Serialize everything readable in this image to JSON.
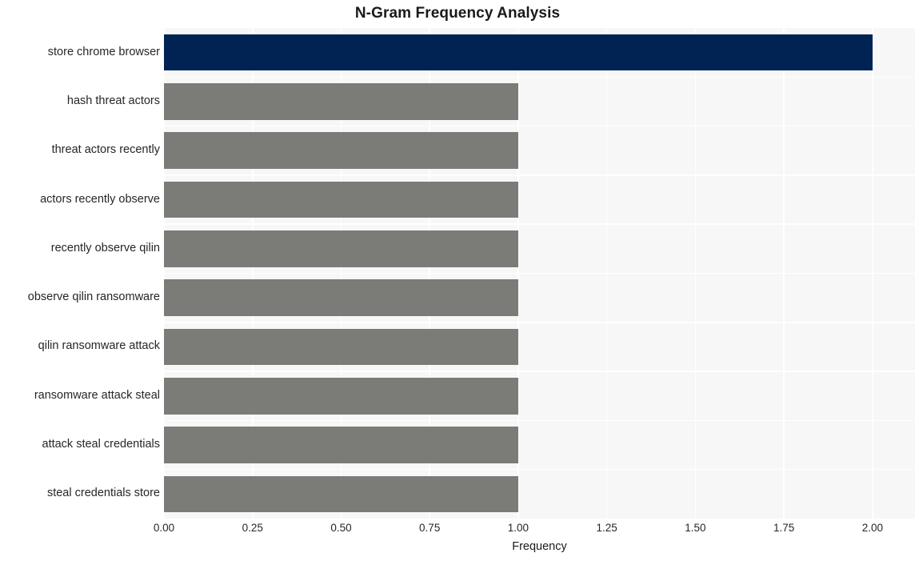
{
  "chart_data": {
    "type": "bar",
    "orientation": "horizontal",
    "title": "N-Gram Frequency Analysis",
    "xlabel": "Frequency",
    "ylabel": "",
    "categories": [
      "store chrome browser",
      "hash threat actors",
      "threat actors recently",
      "actors recently observe",
      "recently observe qilin",
      "observe qilin ransomware",
      "qilin ransomware attack",
      "ransomware attack steal",
      "attack steal credentials",
      "steal credentials store"
    ],
    "values": [
      2,
      1,
      1,
      1,
      1,
      1,
      1,
      1,
      1,
      1
    ],
    "bar_colors": [
      "#012353",
      "#7b7b78",
      "#7b7b78",
      "#7b7b78",
      "#7b7b78",
      "#7b7b78",
      "#7b7b78",
      "#7b7b78",
      "#7b7b78",
      "#7b7b78"
    ],
    "xlim": [
      0,
      2.12
    ],
    "xticks": [
      0,
      0.25,
      0.5,
      0.75,
      1.0,
      1.25,
      1.5,
      1.75,
      2.0
    ],
    "xticklabels": [
      "0.00",
      "0.25",
      "0.50",
      "0.75",
      "1.00",
      "1.25",
      "1.50",
      "1.75",
      "2.00"
    ],
    "grid": true,
    "legend": null,
    "plot_background": "#f7f7f7",
    "grid_color": "#ffffff",
    "figure_background": "#ffffff"
  }
}
